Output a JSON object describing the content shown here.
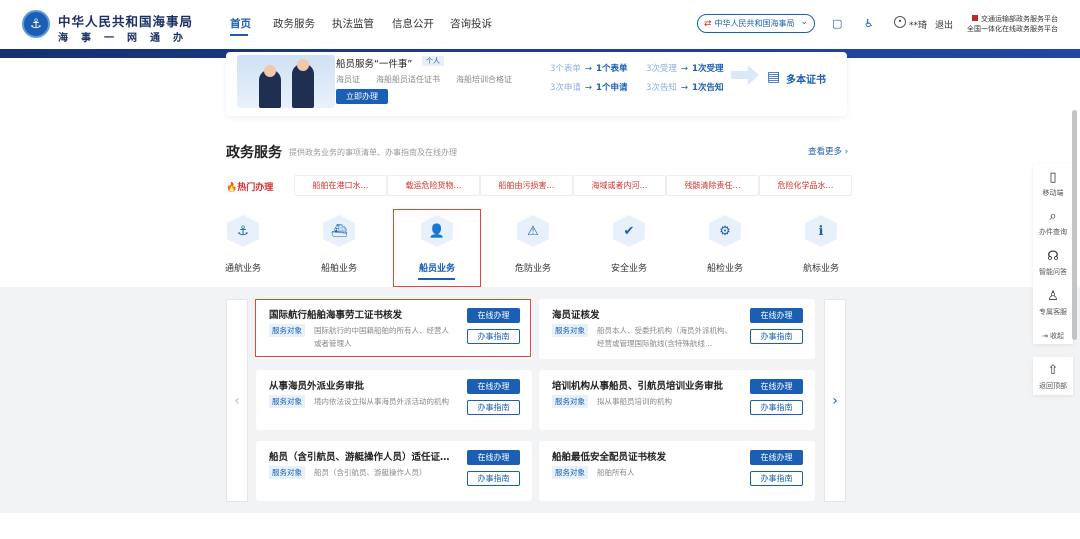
{
  "header": {
    "emblem_icon": "maritime-emblem-icon",
    "title": "中华人民共和国海事局",
    "subtitle": "海事一网通办",
    "nav": [
      "首页",
      "政务服务",
      "执法监管",
      "信息公开",
      "咨询投诉"
    ],
    "org_select": "中华人民共和国海事局",
    "user_name": "**琦",
    "logout": "退出",
    "platform_line1": "交通运输部政务服务平台",
    "platform_line2": "全国一体化在线政务服务平台"
  },
  "banner": {
    "title": "船员服务“一件事”",
    "tag": "个人",
    "items": [
      "海员证",
      "海船船员适任证书",
      "海船培训合格证"
    ],
    "button": "立即办理",
    "flow": [
      {
        "from": "3个表单",
        "to": "1个表单"
      },
      {
        "from": "3次受理",
        "to": "1次受理"
      },
      {
        "from": "3次申请",
        "to": "1个申请"
      },
      {
        "from": "3次告知",
        "to": "1次告知"
      }
    ],
    "cert_label": "多本证书"
  },
  "section": {
    "title": "政务服务",
    "desc": "提供政务业务的事项清单、办事指南及在线办理",
    "more": "查看更多 ›"
  },
  "hot": {
    "label": "热门办理",
    "items": [
      "船舶在港口水…",
      "载运危险货物…",
      "船舶由污损害…",
      "海域或者内河…",
      "残骸清除责任…",
      "危险化学品水…"
    ]
  },
  "categories": [
    {
      "label": "通航业务",
      "icon": "anchor-icon"
    },
    {
      "label": "船舶业务",
      "icon": "ship-icon"
    },
    {
      "label": "船员业务",
      "icon": "crew-icon"
    },
    {
      "label": "危防业务",
      "icon": "hazard-icon"
    },
    {
      "label": "安全业务",
      "icon": "shield-icon"
    },
    {
      "label": "船检业务",
      "icon": "inspection-icon"
    },
    {
      "label": "航标业务",
      "icon": "beacon-icon"
    }
  ],
  "services": [
    {
      "title": "国际航行船舶海事劳工证书核发",
      "tag": "服务对象",
      "desc": "国际航行的中国籍船舶的所有人、经营人或者管理人",
      "online": "在线办理",
      "guide": "办事指南"
    },
    {
      "title": "海员证核发",
      "tag": "服务对象",
      "desc": "船员本人、受委托机构（海员外派机构、经营或管理国际航线(含特殊航线…",
      "online": "在线办理",
      "guide": "办事指南"
    },
    {
      "title": "从事海员外派业务审批",
      "tag": "服务对象",
      "desc": "境内依法设立拟从事海员外派活动的机构",
      "online": "在线办理",
      "guide": "办事指南"
    },
    {
      "title": "培训机构从事船员、引航员培训业务审批",
      "tag": "服务对象",
      "desc": "拟从事船员培训的机构",
      "online": "在线办理",
      "guide": "办事指南"
    },
    {
      "title": "船员（含引航员、游艇操作人员）适任证…",
      "tag": "服务对象",
      "desc": "船员（含引航员、游艇操作人员）",
      "online": "在线办理",
      "guide": "办事指南"
    },
    {
      "title": "船舶最低安全配员证书核发",
      "tag": "服务对象",
      "desc": "船舶所有人",
      "online": "在线办理",
      "guide": "办事指南"
    }
  ],
  "rail": [
    {
      "label": "移动端",
      "icon": "mobile-icon"
    },
    {
      "label": "办件查询",
      "icon": "search-icon"
    },
    {
      "label": "智能问答",
      "icon": "headset-icon"
    },
    {
      "label": "专属客服",
      "icon": "person-icon"
    },
    {
      "label": "收起",
      "icon": "collapse-icon"
    },
    {
      "label": "返回顶部",
      "icon": "back-to-top-icon"
    }
  ]
}
